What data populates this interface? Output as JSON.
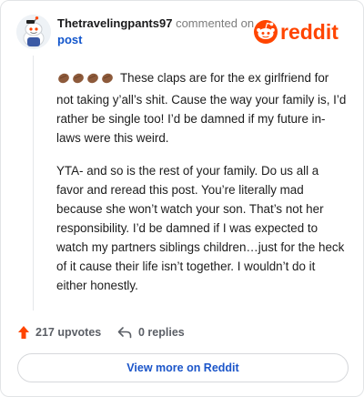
{
  "header": {
    "username": "Thetravelingpants97",
    "action": "commented on",
    "post_link": "post",
    "brand": "reddit"
  },
  "comment": {
    "emoji": "👏🏾👏🏾👏🏾👏🏾",
    "paragraphs": [
      "These claps are for the ex girlfriend for not taking y’all’s shit. Cause the way your family is, I’d rather be single too! I’d be damned if my future in-laws were this weird.",
      "YTA- and so is the rest of your family. Do us all a favor and reread this post. You’re literally mad because she won’t watch your son. That’s not her responsibility. I’d be damned if I was expected to watch my partners siblings children…just for the heck of it cause their life isn’t together. I wouldn’t do it either honestly."
    ]
  },
  "footer": {
    "upvotes": "217 upvotes",
    "replies": "0 replies",
    "view_more": "View more on Reddit"
  },
  "colors": {
    "brand_orange": "#ff4500",
    "link_blue": "#1155cc",
    "clap_brown": "#8d5a3b"
  },
  "icons": [
    "avatar-snoo-icon",
    "reddit-snoo-icon",
    "upvote-arrow-icon",
    "reply-arrow-icon",
    "clap-emoji-icon"
  ]
}
